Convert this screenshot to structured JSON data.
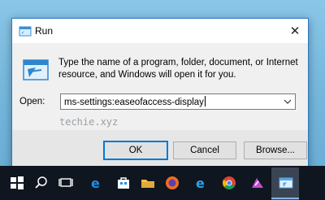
{
  "dialog": {
    "title": "Run",
    "description": "Type the name of a program, folder, document, or Internet resource, and Windows will open it for you.",
    "open_label": "Open:",
    "open_value": "ms-settings:easeofaccess-display",
    "watermark": "techie.xyz",
    "buttons": {
      "ok": "OK",
      "cancel": "Cancel",
      "browse": "Browse..."
    }
  },
  "taskbar": {
    "items": [
      "windows-start-icon",
      "search-icon",
      "task-view-icon",
      "edge-icon",
      "store-icon",
      "file-explorer-icon",
      "firefox-icon",
      "edge-icon-2",
      "chrome-icon",
      "paint-icon",
      "run-icon"
    ]
  },
  "colors": {
    "accent": "#0078d7",
    "dialog_border": "#2b78c6",
    "taskbar": "#10161f"
  }
}
